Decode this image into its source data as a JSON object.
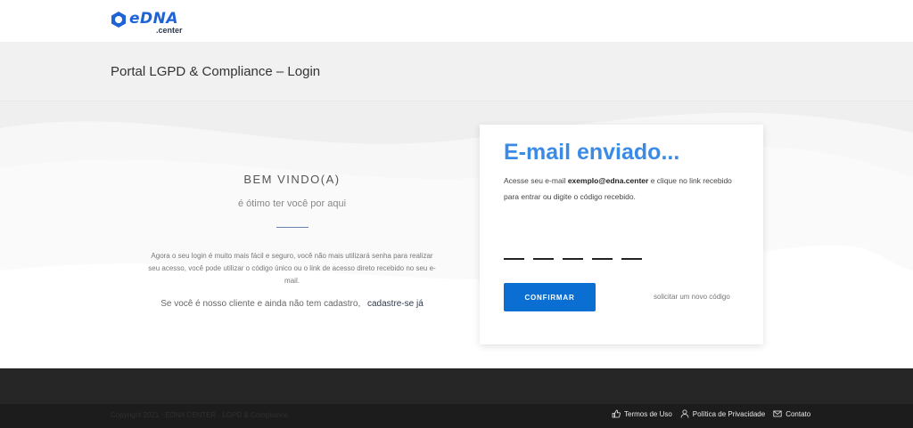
{
  "header": {
    "logo_text": "eDNA",
    "logo_subtext": ".center",
    "page_title": "Portal LGPD & Compliance – Login"
  },
  "welcome": {
    "title": "BEM VINDO(A)",
    "subtitle": "é ótimo ter você por aqui",
    "description": "Agora o seu login é muito mais fácil e seguro, você não mais utilizará senha para realizar seu acesso, você pode utilizar o código único ou o link de acesso direto recebido no seu e-mail.",
    "cta_text": "Se você é nosso cliente e ainda não tem cadastro,",
    "cta_link": "cadastre-se já"
  },
  "login_card": {
    "title": "E-mail enviado...",
    "text_before": "Acesse seu e-mail",
    "email": "exemplo@edna.center",
    "text_after": "e clique no link recebido para entrar ou digite o código recebido.",
    "code_slots": [
      "",
      "",
      "",
      "",
      ""
    ],
    "confirm_label": "CONFIRMAR",
    "new_code_label": "solicitar um novo código",
    "accent_color": "#3a8be5",
    "button_color": "#0a6ed3"
  },
  "footer": {
    "copyright": "Copyright 2021 · EDNA CENTER · LGPD & Compliance",
    "links": [
      {
        "label": "Termos de Uso",
        "icon": "thumbs-up-icon"
      },
      {
        "label": "Política de Privacidade",
        "icon": "user-icon"
      },
      {
        "label": "Contato",
        "icon": "envelope-icon"
      }
    ]
  }
}
